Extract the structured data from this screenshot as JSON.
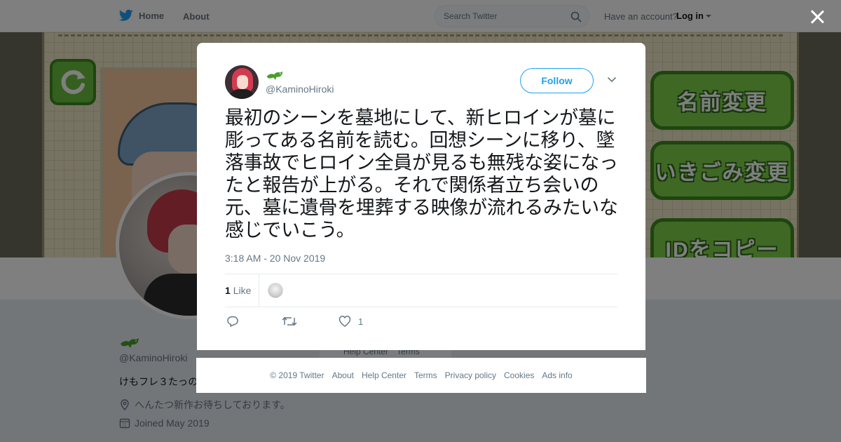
{
  "nav": {
    "home_label": "Home",
    "about_label": "About",
    "search_placeholder": "Search Twitter",
    "have_account_text": "Have an account?",
    "login_label": "Log in"
  },
  "banner": {
    "buttons": [
      "名前変更",
      "いきごみ変更",
      "IDをコピー"
    ]
  },
  "profile": {
    "handle": "@KaminoHiroki",
    "bio": "けもフレ３たっの",
    "location": "へんたつ新作お待ちしております。",
    "joined": "Joined May 2019"
  },
  "background_links": [
    "Help Center",
    "Terms"
  ],
  "tweet": {
    "handle": "@KaminoHiroki",
    "follow_label": "Follow",
    "text": "最初のシーンを墓地にして、新ヒロインが墓に彫ってある名前を読む。回想シーンに移り、墜落事故でヒロイン全員が見るも無残な姿になったと報告が上がる。それで関係者立ち会いの元、墓に遺骨を埋葬する映像が流れるみたいな感じでいこう。",
    "timestamp": "3:18 AM - 20 Nov 2019",
    "likes_count": "1",
    "likes_label": "Like",
    "action_like_count": "1"
  },
  "footer": {
    "links": [
      "© 2019 Twitter",
      "About",
      "Help Center",
      "Terms",
      "Privacy policy",
      "Cookies",
      "Ads info"
    ]
  },
  "colors": {
    "twitter_blue": "#1da1f2",
    "muted_text": "#657786",
    "name_icon_green": "#4a9e2b"
  },
  "icons": {
    "logo": "twitter-bird-icon",
    "search": "search-icon",
    "close": "close-icon",
    "name": "green-lizard-icon",
    "caret": "chevron-down-icon",
    "reply": "reply-icon",
    "retweet": "retweet-icon",
    "like": "heart-icon",
    "location": "location-pin-icon",
    "calendar": "calendar-icon"
  }
}
